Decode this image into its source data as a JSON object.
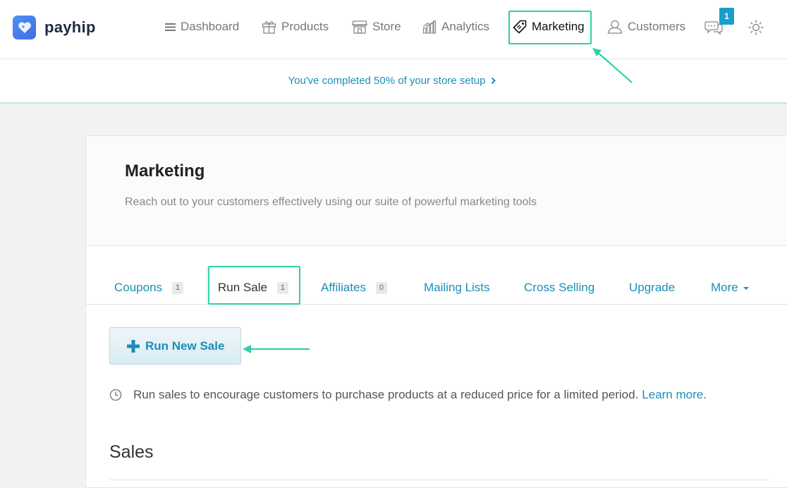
{
  "brand": {
    "name": "payhip"
  },
  "nav": {
    "items": [
      {
        "label": "Dashboard",
        "icon": "menu-icon"
      },
      {
        "label": "Products",
        "icon": "gift-icon"
      },
      {
        "label": "Store",
        "icon": "store-icon"
      },
      {
        "label": "Analytics",
        "icon": "bar-chart-icon"
      },
      {
        "label": "Marketing",
        "icon": "tag-icon",
        "active": true
      },
      {
        "label": "Customers",
        "icon": "user-icon"
      }
    ],
    "messages_badge": "1"
  },
  "setup": {
    "text": "You've completed 50% of your store setup"
  },
  "page": {
    "title": "Marketing",
    "description": "Reach out to your customers effectively using our suite of powerful marketing tools"
  },
  "tabs": [
    {
      "label": "Coupons",
      "count": "1"
    },
    {
      "label": "Run Sale",
      "count": "1",
      "active": true
    },
    {
      "label": "Affiliates",
      "count": "0"
    },
    {
      "label": "Mailing Lists"
    },
    {
      "label": "Cross Selling"
    },
    {
      "label": "Upgrade"
    },
    {
      "label": "More"
    }
  ],
  "run_sale": {
    "button_label": "Run New Sale",
    "info_text": "Run sales to encourage customers to purchase products at a reduced price for a limited period.",
    "learn_more": "Learn more",
    "period": "."
  },
  "sales": {
    "title": "Sales"
  },
  "colors": {
    "accent": "#1a8fb8",
    "highlight": "#2fd0a8",
    "badge": "#1a9ec9"
  }
}
